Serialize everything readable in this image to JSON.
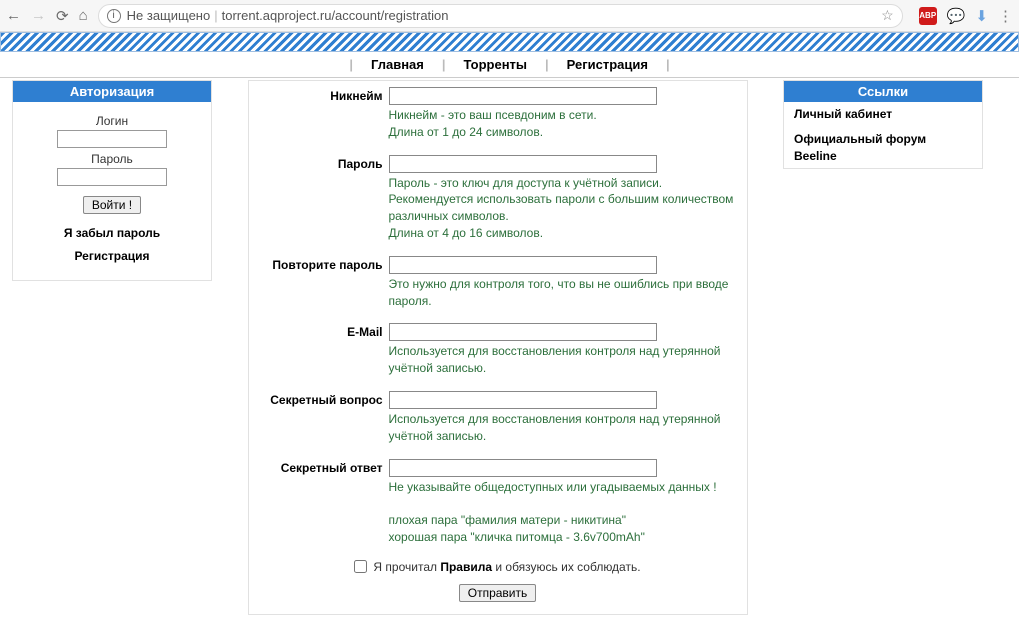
{
  "browser": {
    "insecure": "Не защищено",
    "url": "torrent.aqproject.ru/account/registration",
    "abp": "ABP"
  },
  "menu": {
    "items": [
      "Главная",
      "Торренты",
      "Регистрация"
    ]
  },
  "auth": {
    "title": "Авторизация",
    "login_label": "Логин",
    "password_label": "Пароль",
    "submit": "Войти !",
    "forgot": "Я забыл пароль",
    "register": "Регистрация"
  },
  "links": {
    "title": "Ссылки",
    "items": [
      "Личный кабинет",
      "Официальный форум Beeline"
    ]
  },
  "form": {
    "nick": {
      "label": "Никнейм",
      "hint": "Никнейм - это ваш псевдоним в сети.\nДлина от 1 до 24 символов."
    },
    "pass": {
      "label": "Пароль",
      "hint": "Пароль - это ключ для доступа к учётной записи.\nРекомендуется использовать пароли с большим количеством различных символов.\nДлина от 4 до 16 символов."
    },
    "pass2": {
      "label": "Повторите пароль",
      "hint": "Это нужно для контроля того, что вы не ошиблись при вводе пароля."
    },
    "email": {
      "label": "E-Mail",
      "hint": "Используется для восстановления контроля над утерянной учётной записью."
    },
    "question": {
      "label": "Секретный вопрос",
      "hint": "Используется для восстановления контроля над утерянной учётной записью."
    },
    "answer": {
      "label": "Секретный ответ",
      "hint": "Не указывайте общедоступных или угадываемых данных !\n\nплохая пара \"фамилия матери - никитина\"\nхорошая пара \"кличка питомца - 3.6v700mAh\""
    },
    "agree_pre": "Я прочитал ",
    "agree_link": "Правила",
    "agree_post": " и обязуюсь их соблюдать.",
    "submit": "Отправить"
  }
}
